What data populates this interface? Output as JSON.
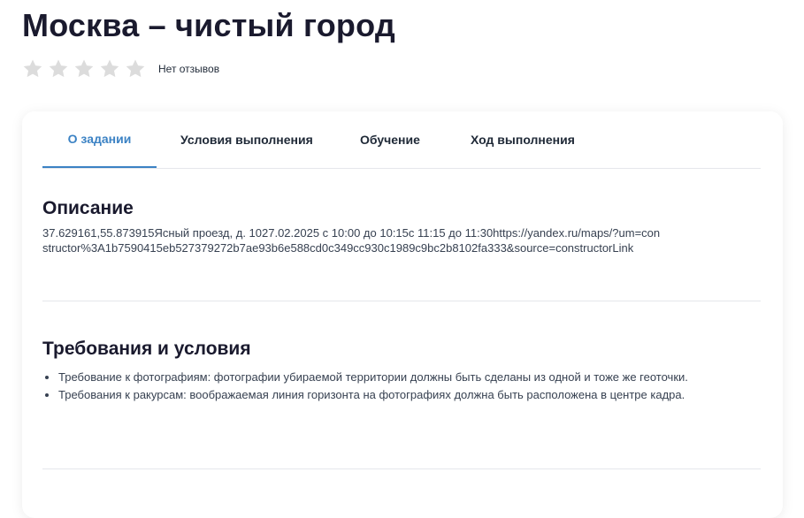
{
  "page": {
    "title": "Москва – чистый город"
  },
  "rating": {
    "stars_filled": 0,
    "stars_total": 5,
    "star_color": "#dcdcdc",
    "reviews_text": "Нет отзывов"
  },
  "tabs": [
    {
      "label": "О задании",
      "active": true
    },
    {
      "label": "Условия выполнения",
      "active": false
    },
    {
      "label": "Обучение",
      "active": false
    },
    {
      "label": "Ход выполнения",
      "active": false
    }
  ],
  "colors": {
    "accent": "#3b82c4",
    "title": "#1a1a2e"
  },
  "description": {
    "title": "Описание",
    "text": "37.629161,55.873915Ясный проезд, д. 1027.02.2025 с 10:00 до 10:15с 11:15 до 11:30https://yandex.ru/maps/?um=constructor%3A1b7590415eb527379272b7ae93b6e588cd0c349cc930c1989c9bc2b8102fa333&source=constructorLink"
  },
  "requirements": {
    "title": "Требования и условия",
    "items": [
      "Требование к фотографиям: фотографии убираемой территории должны быть сделаны из одной и тоже же геоточки.",
      "Требования к ракурсам: воображаемая линия горизонта на фотографиях должна быть расположена в центре кадра."
    ]
  }
}
